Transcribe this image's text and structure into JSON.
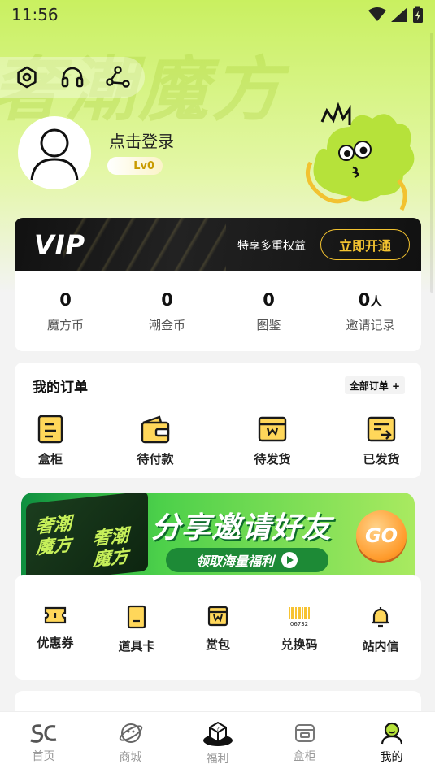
{
  "status_bar": {
    "time": "11:56"
  },
  "hero": {
    "watermark": "奢潮魔方"
  },
  "profile": {
    "login_text": "点击登录",
    "level": "Lv0"
  },
  "vip": {
    "logo": "VIP",
    "perks": "特享多重权益",
    "open_button": "立即开通"
  },
  "stats": [
    {
      "value": "0",
      "unit": "",
      "label": "魔方币"
    },
    {
      "value": "0",
      "unit": "",
      "label": "潮金币"
    },
    {
      "value": "0",
      "unit": "",
      "label": "图鉴"
    },
    {
      "value": "0",
      "unit": "人",
      "label": "邀请记录"
    }
  ],
  "orders": {
    "title": "我的订单",
    "all_link": "全部订单 +",
    "items": [
      {
        "label": "盒柜",
        "icon": "cabinet-icon"
      },
      {
        "label": "待付款",
        "icon": "wallet-icon"
      },
      {
        "label": "待发货",
        "icon": "box-icon"
      },
      {
        "label": "已发货",
        "icon": "shipped-icon"
      }
    ]
  },
  "banner": {
    "cube_text_1": "奢潮\n魔方",
    "cube_text_2": "奢潮\n魔方",
    "title": "分享邀请好友",
    "subtitle": "领取海量福利",
    "go": "GO"
  },
  "tools": [
    {
      "label": "优惠券",
      "icon": "coupon-icon",
      "code": ""
    },
    {
      "label": "道具卡",
      "icon": "card-icon",
      "code": ""
    },
    {
      "label": "赏包",
      "icon": "reward-bag-icon",
      "code": ""
    },
    {
      "label": "兑换码",
      "icon": "barcode-icon",
      "code": "06732"
    },
    {
      "label": "站内信",
      "icon": "bell-icon",
      "code": ""
    }
  ],
  "tabbar": [
    {
      "label": "首页",
      "icon": "home-logo-icon",
      "active": false
    },
    {
      "label": "商城",
      "icon": "planet-icon",
      "active": false
    },
    {
      "label": "福利",
      "icon": "welfare-icon",
      "active": false
    },
    {
      "label": "盒柜",
      "icon": "cabinet-icon",
      "active": false
    },
    {
      "label": "我的",
      "icon": "user-icon",
      "active": true
    }
  ],
  "colors": {
    "accent": "#f2c230",
    "hero_green": "#c9f060",
    "icon_yellow": "#f5b400"
  }
}
